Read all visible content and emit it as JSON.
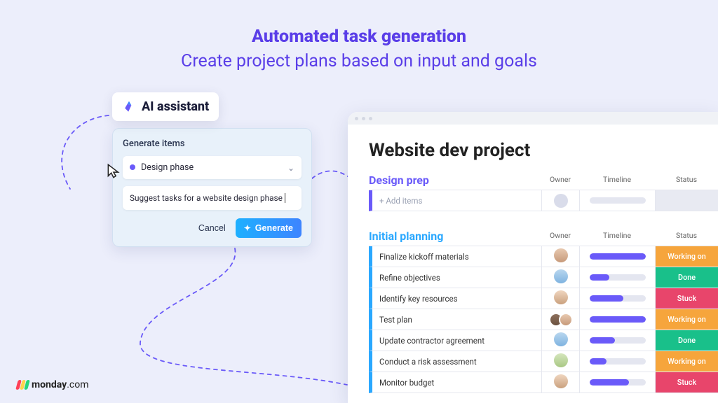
{
  "hero": {
    "title": "Automated task generation",
    "subtitle": "Create project plans based on input and goals"
  },
  "assistant": {
    "header": "AI assistant",
    "panel_title": "Generate items",
    "select_value": "Design phase",
    "prompt_value": "Suggest tasks for a website design phase",
    "cancel_label": "Cancel",
    "generate_label": "Generate"
  },
  "board": {
    "title": "Website dev project",
    "columns": {
      "owner": "Owner",
      "timeline": "Timeline",
      "status": "Status"
    },
    "groups": [
      {
        "name": "Design prep",
        "color": "#6a5af9",
        "rows": [
          {
            "task": "+ Add items",
            "is_add": true,
            "owner": [],
            "timeline_fill": 0,
            "status": ""
          }
        ]
      },
      {
        "name": "Initial planning",
        "color": "#2aa8ff",
        "rows": [
          {
            "task": "Finalize kickoff materials",
            "owner": [
              "a1"
            ],
            "timeline_fill": 100,
            "status": "Working on"
          },
          {
            "task": "Refine objectives",
            "owner": [
              "a2"
            ],
            "timeline_fill": 35,
            "status": "Done"
          },
          {
            "task": "Identify key resources",
            "owner": [
              "a3"
            ],
            "timeline_fill": 60,
            "status": "Stuck"
          },
          {
            "task": "Test plan",
            "owner": [
              "a4",
              "a1"
            ],
            "timeline_fill": 100,
            "status": "Working on"
          },
          {
            "task": "Update contractor agreement",
            "owner": [
              "a2"
            ],
            "timeline_fill": 45,
            "status": "Done"
          },
          {
            "task": "Conduct a risk assessment",
            "owner": [
              "a5"
            ],
            "timeline_fill": 30,
            "status": "Working on"
          },
          {
            "task": "Monitor budget",
            "owner": [
              "a3"
            ],
            "timeline_fill": 70,
            "status": "Stuck"
          }
        ]
      }
    ]
  },
  "brand": {
    "name": "monday",
    "suffix": ".com"
  }
}
